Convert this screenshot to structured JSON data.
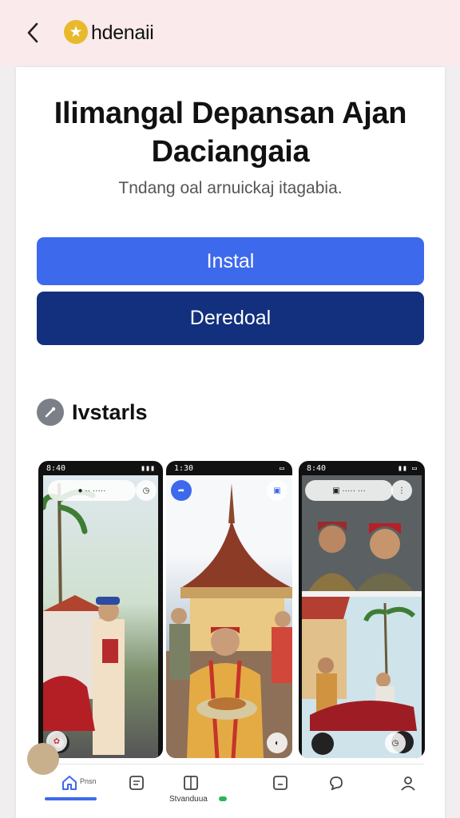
{
  "topbar": {
    "back_icon": "chevron-left-icon",
    "brand_icon": "star-logo-icon",
    "brand_name": "hdenaii",
    "colors": {
      "background": "#fbeaec",
      "logo": "#e8b92c"
    }
  },
  "hero": {
    "title": "Ilimangal Depansan Ajan Daciangaia",
    "subtitle": "Tndang oal arnuickaj itagabia."
  },
  "actions": {
    "install_label": "Instal",
    "download_label": "Deredoal",
    "colors": {
      "install": "#3d69ec",
      "download": "#12307d"
    }
  },
  "screenshots_section": {
    "icon": "wrench-icon",
    "title": "Ivstarls",
    "phones": [
      {
        "status_time": "8:40"
      },
      {
        "status_time": "1:30"
      },
      {
        "status_time": "8:40"
      }
    ]
  },
  "bottom_nav": {
    "items": [
      {
        "icon": "home-icon",
        "label": "Pnsn"
      },
      {
        "icon": "list-icon",
        "label": ""
      },
      {
        "icon": "book-icon",
        "label": ""
      },
      {
        "icon": "note-icon",
        "label": ""
      },
      {
        "icon": "chat-icon",
        "label": ""
      },
      {
        "icon": "profile-icon",
        "label": ""
      }
    ],
    "progress_text": "Stvanduua"
  }
}
